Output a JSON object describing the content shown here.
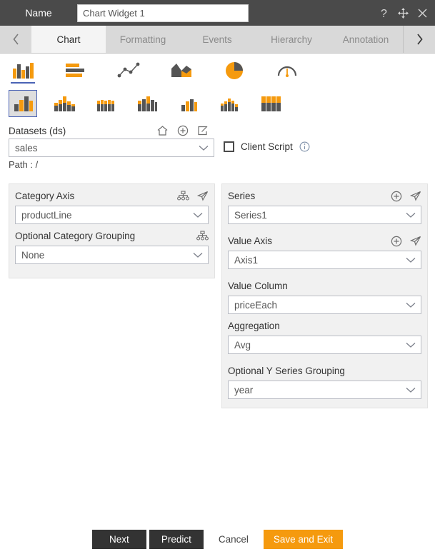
{
  "titlebar": {
    "name_label": "Name",
    "widget_name": "Chart Widget 1",
    "name_placeholder": "Chart Widget 1",
    "help_icon": "question-mark-icon",
    "move_icon": "move-arrows-icon",
    "close_icon": "close-icon"
  },
  "tabs": {
    "prev_label": "‹",
    "next_label": "›",
    "items": [
      {
        "label": "Chart",
        "active": true
      },
      {
        "label": "Formatting",
        "active": false
      },
      {
        "label": "Events",
        "active": false
      },
      {
        "label": "Hierarchy",
        "active": false
      },
      {
        "label": "Annotation",
        "active": false
      }
    ]
  },
  "chart_types": {
    "row1": [
      {
        "name": "column-chart-icon",
        "selected": true
      },
      {
        "name": "bar-chart-icon",
        "selected": false
      },
      {
        "name": "scatter-line-chart-icon",
        "selected": false
      },
      {
        "name": "area-chart-icon",
        "selected": false
      },
      {
        "name": "pie-chart-icon",
        "selected": false
      },
      {
        "name": "gauge-chart-icon",
        "selected": false
      }
    ],
    "row2": [
      {
        "name": "clustered-column-icon",
        "selected": true
      },
      {
        "name": "stacked-column-icon",
        "selected": false
      },
      {
        "name": "stacked-column-100-icon",
        "selected": false
      },
      {
        "name": "grouped-column-icon",
        "selected": false
      },
      {
        "name": "small-clustered-column-icon",
        "selected": false
      },
      {
        "name": "mixed-column-icon",
        "selected": false
      },
      {
        "name": "full-stacked-column-icon",
        "selected": false
      }
    ]
  },
  "datasets": {
    "label": "Datasets (ds)",
    "home_icon": "home-icon",
    "add_icon": "plus-circle-icon",
    "edit_icon": "edit-pencil-icon",
    "value": "sales",
    "path_label": "Path :",
    "path_value": "/",
    "client_script_label": "Client Script",
    "client_script_checked": false,
    "client_script_info_icon": "info-icon"
  },
  "left_panel": {
    "category_axis": {
      "label": "Category Axis",
      "hierarchy_icon": "hierarchy-icon",
      "send_icon": "send-icon",
      "value": "productLine"
    },
    "optional_category_grouping": {
      "label": "Optional Category Grouping",
      "hierarchy_icon": "hierarchy-icon",
      "value": "None"
    }
  },
  "right_panel": {
    "series": {
      "label": "Series",
      "add_icon": "plus-circle-icon",
      "send_icon": "send-icon",
      "value": "Series1"
    },
    "value_axis": {
      "label": "Value Axis",
      "add_icon": "plus-circle-icon",
      "send_icon": "send-icon",
      "value": "Axis1"
    },
    "value_column": {
      "label": "Value Column",
      "value": "priceEach"
    },
    "aggregation": {
      "label": "Aggregation",
      "value": "Avg"
    },
    "optional_y_series_grouping": {
      "label": "Optional Y Series Grouping",
      "value": "year"
    }
  },
  "footer": {
    "next": "Next",
    "predict": "Predict",
    "cancel": "Cancel",
    "save_and_exit": "Save and Exit"
  },
  "colors": {
    "accent": "#f59a0e",
    "dark": "#333333",
    "titlebar": "#4a4a4a",
    "tabbar": "#d9d9d9",
    "selection": "#4a63b5",
    "icon_gray": "#555555"
  }
}
